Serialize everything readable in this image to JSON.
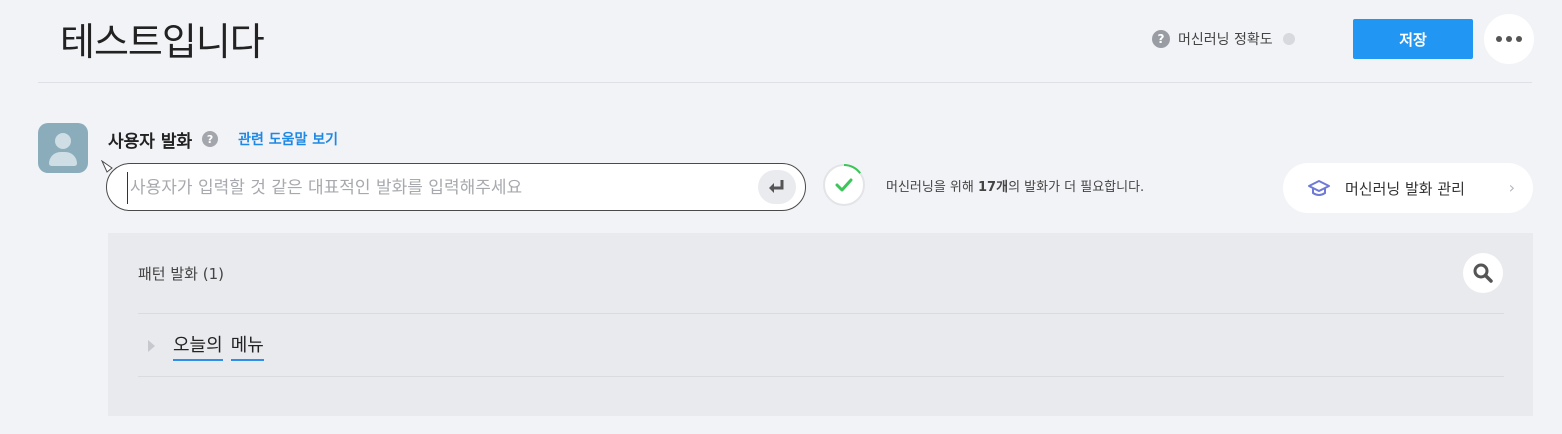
{
  "header": {
    "title": "테스트입니다",
    "ml_accuracy_label": "머신러닝 정확도",
    "save_label": "저장"
  },
  "user_utterance": {
    "label": "사용자 발화",
    "help_link": "관련 도움말 보기",
    "input_placeholder": "사용자가 입력할 것 같은 대표적인 발화를 입력해주세요",
    "input_value": "",
    "ml_progress_prefix": "머신러닝을 위해 ",
    "ml_progress_count": "17개",
    "ml_progress_suffix": "의 발화가 더 필요합니다.",
    "ml_manage_label": "머신러닝 발화 관리",
    "progress_fraction": 0.15
  },
  "patterns": {
    "title": "패턴 발화 (1)",
    "items": [
      {
        "tokens": [
          "오늘의",
          "메뉴"
        ]
      }
    ]
  },
  "colors": {
    "primary": "#2196f3",
    "link": "#1e88e5",
    "success": "#3cc65a",
    "token_underline": "#2e8ee8"
  },
  "icons": [
    "question-icon",
    "more-icon",
    "user-avatar-icon",
    "enter-icon",
    "check-icon",
    "graduation-cap-icon",
    "chevron-right-icon",
    "search-icon",
    "expand-triangle-icon"
  ]
}
